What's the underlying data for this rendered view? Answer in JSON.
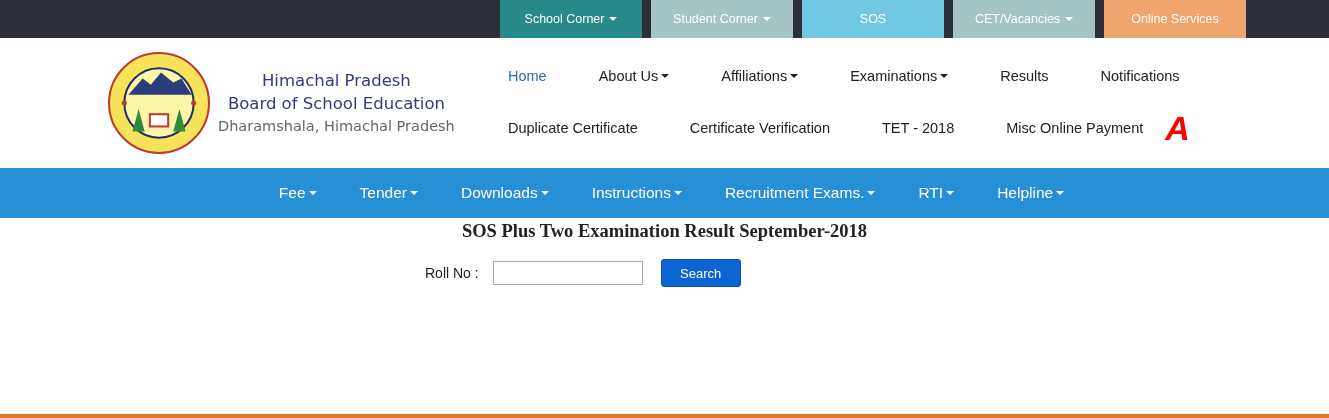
{
  "top_bar": [
    {
      "label": "School Corner",
      "caret": true,
      "color": "#27898a"
    },
    {
      "label": "Student Corner",
      "caret": true,
      "color": "#a3c6c4"
    },
    {
      "label": "SOS",
      "caret": false,
      "color": "#72c7e3"
    },
    {
      "label": "CET/Vacancies",
      "caret": true,
      "color": "#a3c6c4"
    },
    {
      "label": "Online Services",
      "caret": false,
      "color": "#f0a56f"
    }
  ],
  "brand": {
    "title_line_1": "Himachal Pradesh",
    "title_line_2": "Board of School Education",
    "subtitle": "Dharamshala, Himachal Pradesh"
  },
  "main_nav": [
    [
      {
        "kind": "link",
        "label": "Home",
        "caret": false,
        "selected": true
      },
      {
        "kind": "link",
        "label": "About Us",
        "caret": true,
        "selected": false
      },
      {
        "kind": "link",
        "label": "Affiliations",
        "caret": true,
        "selected": false
      },
      {
        "kind": "link",
        "label": "Examinations",
        "caret": true,
        "selected": false
      },
      {
        "kind": "link",
        "label": "Results",
        "caret": false,
        "selected": false
      },
      {
        "kind": "link",
        "label": "Notifications",
        "caret": false,
        "selected": false
      }
    ],
    [
      {
        "kind": "link",
        "label": "Duplicate Certificate",
        "caret": false,
        "selected": false
      },
      {
        "kind": "link",
        "label": "Certificate Verification",
        "caret": false,
        "selected": false
      },
      {
        "kind": "link",
        "label": "TET - 2018",
        "caret": false,
        "selected": false
      },
      {
        "kind": "link",
        "label": "Misc Online Payment",
        "caret": false,
        "selected": false
      },
      {
        "kind": "font-toggle",
        "label": "A"
      }
    ]
  ],
  "sub_nav": [
    {
      "label": "Fee",
      "caret": true
    },
    {
      "label": "Tender",
      "caret": true
    },
    {
      "label": "Downloads",
      "caret": true
    },
    {
      "label": "Instructions",
      "caret": true
    },
    {
      "label": "Recruitment Exams.",
      "caret": true
    },
    {
      "label": "RTI",
      "caret": true
    },
    {
      "label": "Helpline",
      "caret": true
    }
  ],
  "page_title": "SOS Plus Two Examination Result September-2018",
  "form": {
    "label": "Roll No :",
    "button": "Search"
  }
}
